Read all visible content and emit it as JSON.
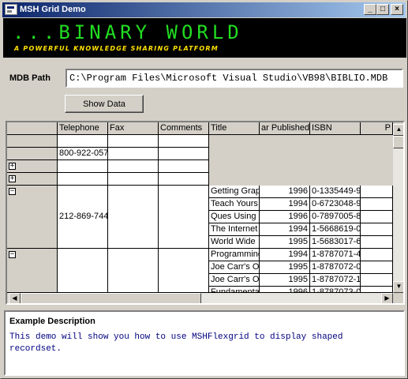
{
  "window": {
    "title": "MSH Grid Demo",
    "minimize": "_",
    "maximize": "□",
    "close": "×"
  },
  "banner": {
    "title": "...BINARY WORLD",
    "tagline": "A POWERFUL KNOWLEDGE SHARING PLATFORM"
  },
  "path": {
    "label": "MDB Path",
    "value": "C:\\Program Files\\Microsoft Visual Studio\\VB98\\BIBLIO.MDB"
  },
  "show_button": "Show Data",
  "grid": {
    "headers": [
      "Telephone",
      "Fax",
      "Comments",
      "Title",
      "ar Published",
      "ISBN",
      "P"
    ],
    "phones": [
      "800-922-057",
      "212-869-744"
    ],
    "expanders": [
      "+",
      "+",
      "−",
      "−"
    ],
    "titles": [
      {
        "title": "Getting Grap",
        "year": "1996",
        "isbn": "0-1335449-9"
      },
      {
        "title": "Teach Yours",
        "year": "1994",
        "isbn": "0-6723048-9"
      },
      {
        "title": "Ques Using",
        "year": "1996",
        "isbn": "0-7897005-8"
      },
      {
        "title": "The Internet",
        "year": "1994",
        "isbn": "1-5668619-0"
      },
      {
        "title": "World Wide",
        "year": "1995",
        "isbn": "1-5683017-6"
      },
      {
        "title": "Programming",
        "year": "1994",
        "isbn": "1-8787071-4"
      },
      {
        "title": "Joe Carr's O",
        "year": "1995",
        "isbn": "1-8787072-0"
      },
      {
        "title": "Joe Carr's O",
        "year": "1995",
        "isbn": "1-8787072-1"
      },
      {
        "title": "Fundamenta",
        "year": "1996",
        "isbn": "1-8787073-0"
      }
    ]
  },
  "description": {
    "title": "Example Description",
    "body": "This demo will show you how to use MSHFlexgrid to display shaped recordset."
  }
}
